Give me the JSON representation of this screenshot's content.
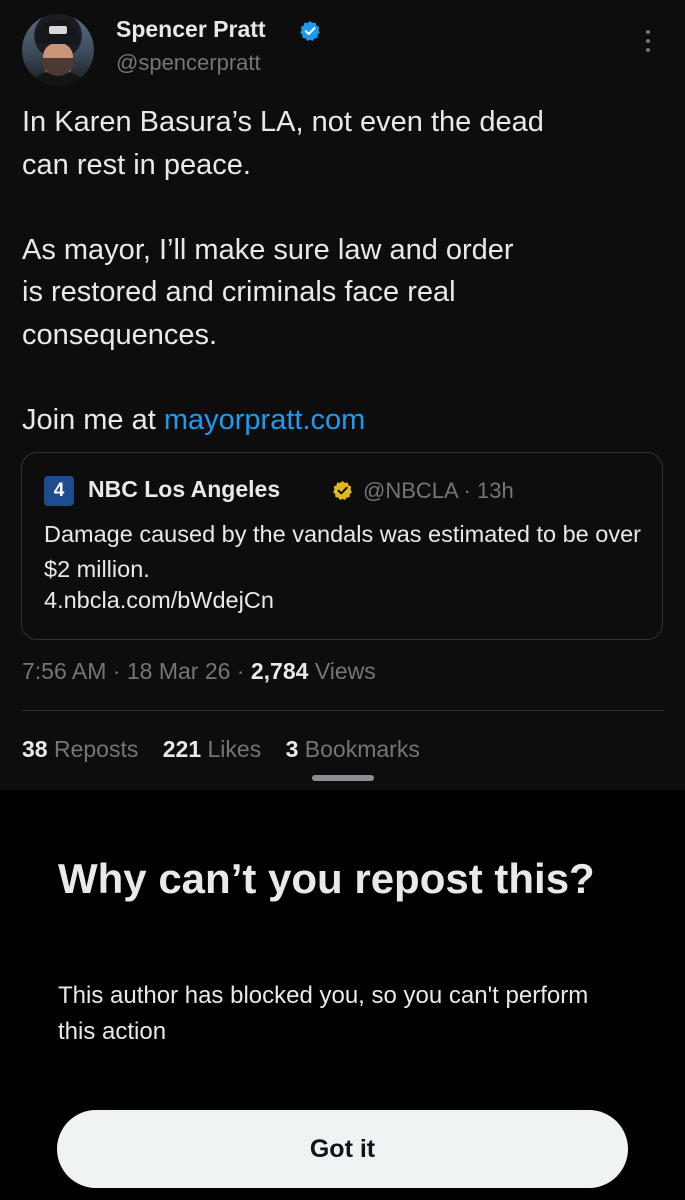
{
  "tweet": {
    "author": {
      "display_name": "Spencer Pratt",
      "handle": "@spencerpratt",
      "verified_color": "#1d9bf0"
    },
    "paragraphs": [
      "In Karen Basura’s LA, not even the dead\ncan rest in peace.",
      "As mayor, I’ll make sure law and order\nis restored and criminals face real\nconsequences."
    ],
    "cta_prefix": "Join me at ",
    "cta_link": "mayorpratt.com",
    "quote": {
      "logo_text": "4",
      "name": "NBC Los Angeles",
      "verified_color": "#e2b719",
      "handle": "@NBCLA",
      "time": "13h",
      "text": "Damage caused by the vandals was estimated to be over $2 million.",
      "url": "4.nbcla.com/bWdejCn"
    },
    "time": "7:56 AM",
    "date": "18 Mar 26",
    "views_count": "2,784",
    "views_label": "Views",
    "stats": [
      {
        "count": "38",
        "label": "Reposts"
      },
      {
        "count": "221",
        "label": "Likes"
      },
      {
        "count": "3",
        "label": "Bookmarks"
      }
    ]
  },
  "sheet": {
    "title": "Why can’t you repost this?",
    "body": "This author has blocked you, so you can't perform this action",
    "button_label": "Got it"
  },
  "icons": {
    "verified": "verified-badge-icon",
    "more": "more-vertical-icon"
  },
  "colors": {
    "link": "#1d9bf0",
    "muted": "#71767b",
    "text": "#e7e9ea",
    "button_bg": "#eff3f4"
  }
}
